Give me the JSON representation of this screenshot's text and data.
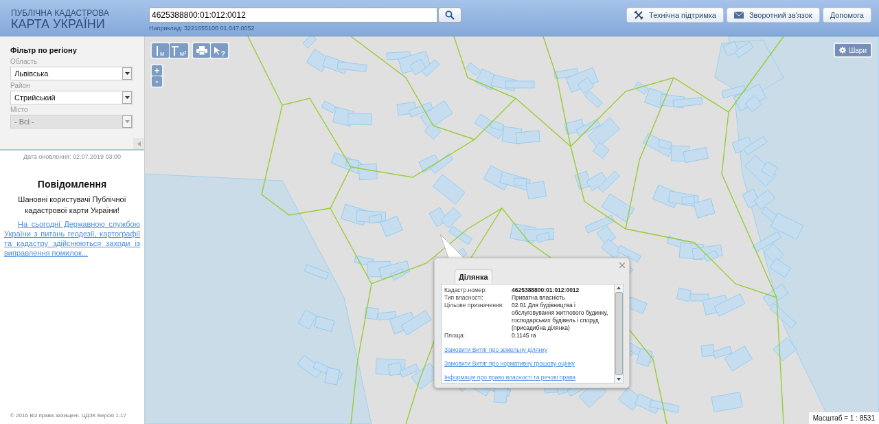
{
  "header": {
    "logo_top": "ПУБЛІЧНА КАДАСТРОВА",
    "logo_bottom": "КАРТА УКРАЇНИ",
    "search": {
      "value": "4625388800:01:012:0012"
    },
    "search_hint": "Наприклад: 3221655100 01.047.0052",
    "buttons": [
      {
        "kind": "support",
        "label": "Технічна підтримка"
      },
      {
        "kind": "mail",
        "label": "Зворотний зв'язок"
      },
      {
        "kind": "plain",
        "label": "Допомога"
      }
    ]
  },
  "filter": {
    "title": "Фільтр по регіону",
    "fields": [
      {
        "label": "Область",
        "value": "Львівська",
        "disabled": false
      },
      {
        "label": "Район",
        "value": "Стрийський",
        "disabled": false
      },
      {
        "label": "Місто",
        "value": "- Всі -",
        "disabled": true
      }
    ]
  },
  "update_date": "Дата оновлення: 02.07.2019 03:00",
  "notice": {
    "title": "Повідомлення",
    "greeting": "Шановні користувачі Публічної кадастрової карти України!",
    "link": "На сьогодні Державною службою України з питань геодезії, картографії та кадастру здійснюються заходи із виправлення помилок..."
  },
  "footer": "© 2016 Всі права захищені. ЦДЗК Версія 1.17",
  "map": {
    "tools": [
      {
        "kind": "distance",
        "label": "м"
      },
      {
        "kind": "area",
        "label": "м²"
      },
      {
        "kind": "print"
      },
      {
        "kind": "identify",
        "label": "?"
      }
    ],
    "zoom": [
      "+",
      "-"
    ],
    "layers_button": "Шари",
    "scale": "Масштаб = 1 : 8531",
    "popup": {
      "tabs": [
        {
          "label": "Ділянка",
          "selected": true
        }
      ],
      "rows": [
        {
          "label": "Кадастр.номер:",
          "value": "4625388800:01:012:0012",
          "bold": true
        },
        {
          "label": "Тип власності:",
          "value": "Приватна власність",
          "bold": false
        },
        {
          "label": "Цільове призначення:",
          "value": "02.01 Для будівництва і обслуговування житлового будинку, господарських будівель і споруд (присадибна ділянка)",
          "bold": false
        },
        {
          "label": "Площа:",
          "value": "0.1145 га",
          "bold": false
        }
      ],
      "links": [
        "Замовити Витяг про земельну ділянку",
        "Замовити Витяг про нормативну грошову оцінку",
        "Інформація про право власності та речові права"
      ]
    }
  }
}
